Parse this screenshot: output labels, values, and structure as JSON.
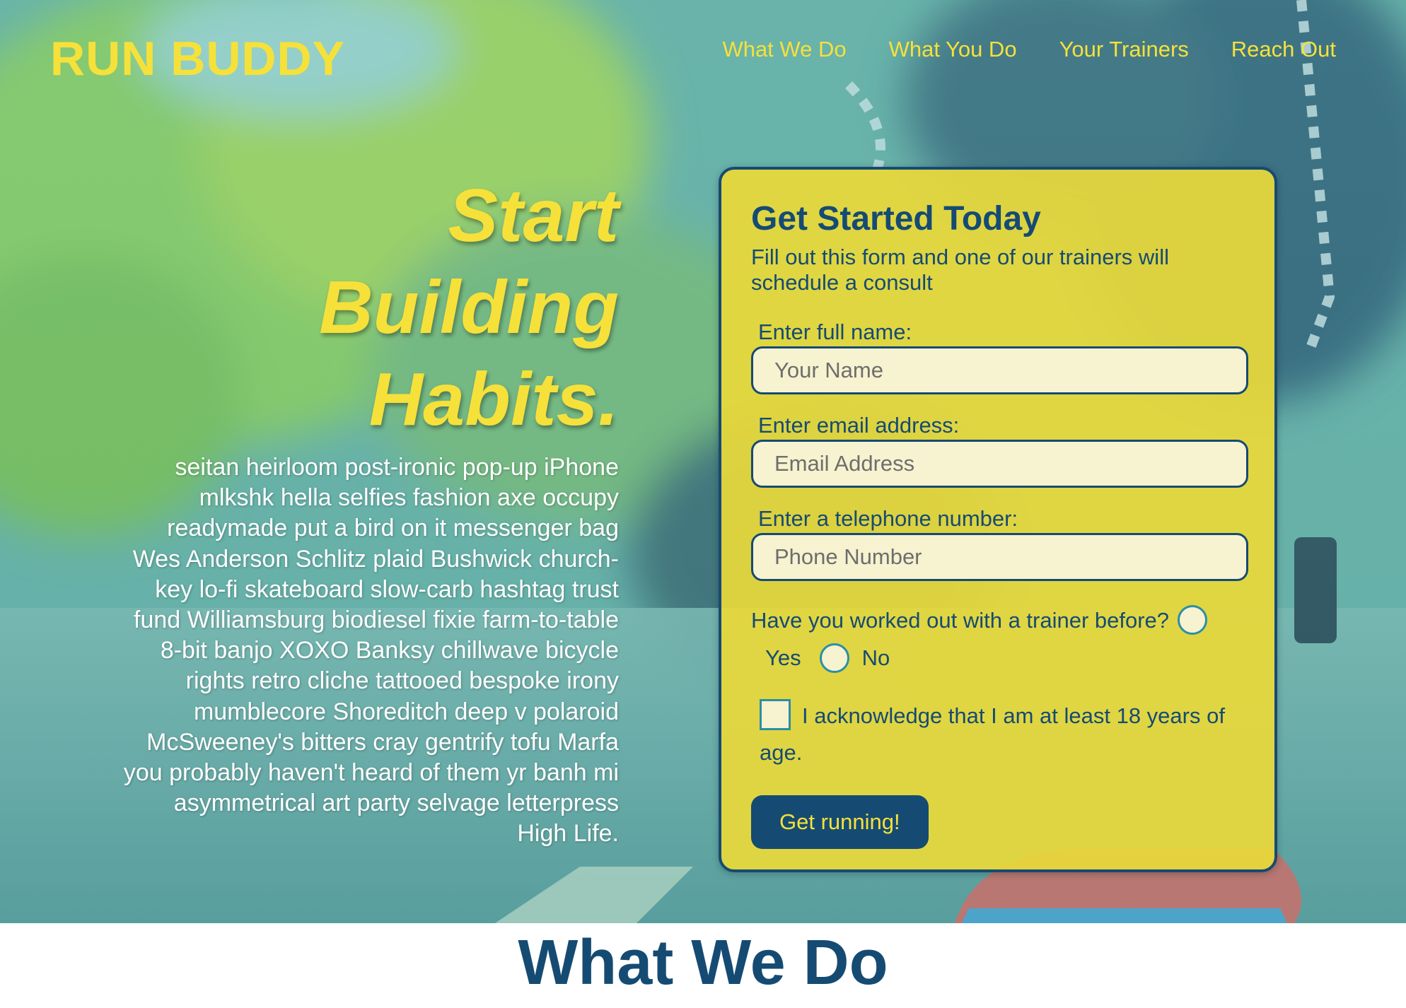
{
  "header": {
    "logo": "RUN BUDDY",
    "nav": [
      "What We Do",
      "What You Do",
      "Your Trainers",
      "Reach Out"
    ]
  },
  "hero": {
    "title_lines": [
      "Start",
      "Building",
      "Habits."
    ],
    "body": "seitan heirloom post-ironic pop-up iPhone mlkshk hella selfies fashion axe occupy readymade put a bird on it messenger bag Wes Anderson Schlitz plaid Bushwick church-key lo-fi skateboard slow-carb hashtag trust fund Williamsburg biodiesel fixie farm-to-table 8-bit banjo XOXO Banksy chillwave bicycle rights retro cliche tattooed bespoke irony mumblecore Shoreditch deep v polaroid McSweeney's bitters cray gentrify tofu Marfa you probably haven't heard of them yr banh mi asymmetrical art party selvage letterpress High Life."
  },
  "form": {
    "title": "Get Started Today",
    "subtitle": "Fill out this form and one of our trainers will schedule a consult",
    "name_label": "Enter full name:",
    "name_placeholder": "Your Name",
    "name_value": "",
    "email_label": "Enter email address:",
    "email_placeholder": "Email Address",
    "email_value": "",
    "phone_label": "Enter a telephone number:",
    "phone_placeholder": "Phone Number",
    "phone_value": "",
    "trainer_question": "Have you worked out with a trainer before?",
    "yes_label": "Yes",
    "no_label": "No",
    "ack_label": "I acknowledge that I am at least 18 years of age.",
    "submit_label": "Get running!"
  },
  "sections": {
    "what_we_do_title": "What We Do"
  },
  "colors": {
    "brand_yellow": "#f6e13a",
    "brand_navy": "#154b73",
    "input_bg": "#f7f2cf",
    "radio_border": "#2a8fa8"
  },
  "icons": {
    "radio": "radio-circle",
    "checkbox": "checkbox-square"
  }
}
